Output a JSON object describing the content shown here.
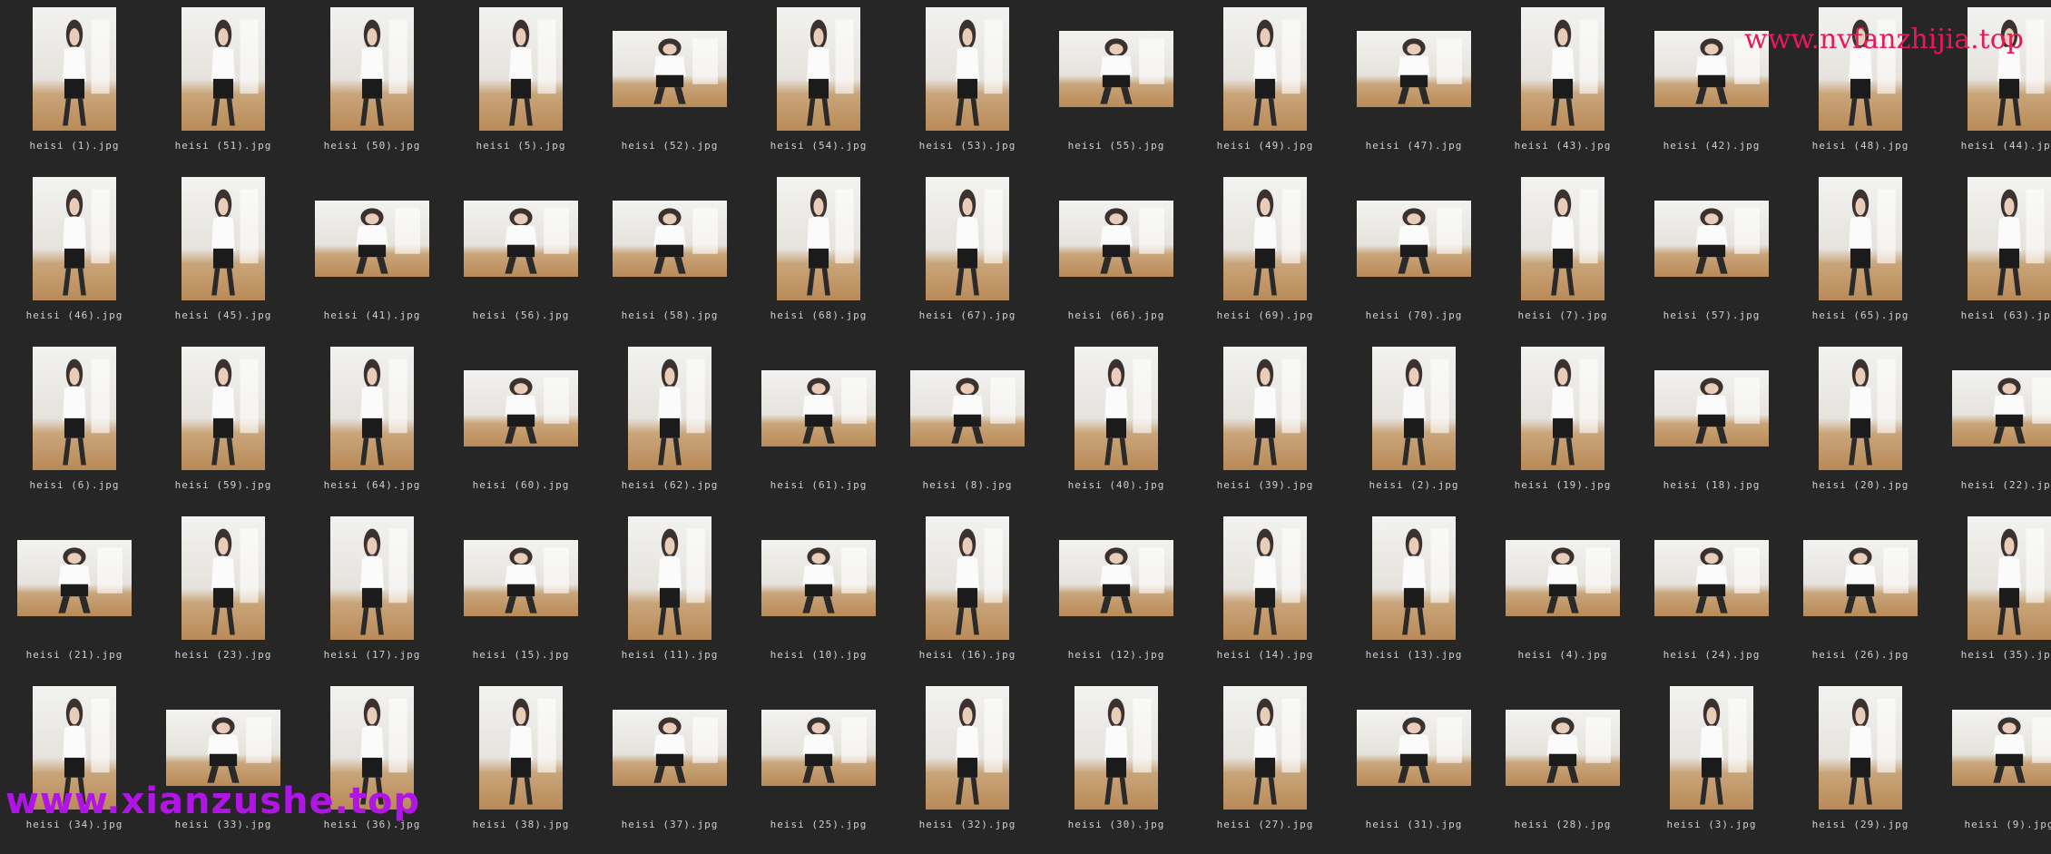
{
  "window": {
    "name": "thumbnail-view"
  },
  "watermarks": {
    "top_right": "www.nvfanzhijia.top",
    "bottom_left": "www.xianzushe.top"
  },
  "rows": [
    [
      {
        "label": "heisi (1).jpg",
        "orientation": "portrait"
      },
      {
        "label": "heisi (51).jpg",
        "orientation": "portrait"
      },
      {
        "label": "heisi (50).jpg",
        "orientation": "portrait"
      },
      {
        "label": "heisi (5).jpg",
        "orientation": "portrait"
      },
      {
        "label": "heisi (52).jpg",
        "orientation": "landscape"
      },
      {
        "label": "heisi (54).jpg",
        "orientation": "portrait"
      },
      {
        "label": "heisi (53).jpg",
        "orientation": "portrait"
      },
      {
        "label": "heisi (55).jpg",
        "orientation": "landscape"
      },
      {
        "label": "heisi (49).jpg",
        "orientation": "portrait"
      },
      {
        "label": "heisi (47).jpg",
        "orientation": "landscape"
      },
      {
        "label": "heisi (43).jpg",
        "orientation": "portrait"
      },
      {
        "label": "heisi (42).jpg",
        "orientation": "landscape"
      },
      {
        "label": "heisi (48).jpg",
        "orientation": "portrait"
      },
      {
        "label": "heisi (44).jpg",
        "orientation": "portrait"
      }
    ],
    [
      {
        "label": "heisi (46).jpg",
        "orientation": "portrait"
      },
      {
        "label": "heisi (45).jpg",
        "orientation": "portrait"
      },
      {
        "label": "heisi (41).jpg",
        "orientation": "landscape"
      },
      {
        "label": "heisi (56).jpg",
        "orientation": "landscape"
      },
      {
        "label": "heisi (58).jpg",
        "orientation": "landscape"
      },
      {
        "label": "heisi (68).jpg",
        "orientation": "portrait"
      },
      {
        "label": "heisi (67).jpg",
        "orientation": "portrait"
      },
      {
        "label": "heisi (66).jpg",
        "orientation": "landscape"
      },
      {
        "label": "heisi (69).jpg",
        "orientation": "portrait"
      },
      {
        "label": "heisi (70).jpg",
        "orientation": "landscape"
      },
      {
        "label": "heisi (7).jpg",
        "orientation": "portrait"
      },
      {
        "label": "heisi (57).jpg",
        "orientation": "landscape"
      },
      {
        "label": "heisi (65).jpg",
        "orientation": "portrait"
      },
      {
        "label": "heisi (63).jpg",
        "orientation": "portrait"
      }
    ],
    [
      {
        "label": "heisi (6).jpg",
        "orientation": "portrait"
      },
      {
        "label": "heisi (59).jpg",
        "orientation": "portrait"
      },
      {
        "label": "heisi (64).jpg",
        "orientation": "portrait"
      },
      {
        "label": "heisi (60).jpg",
        "orientation": "landscape"
      },
      {
        "label": "heisi (62).jpg",
        "orientation": "portrait"
      },
      {
        "label": "heisi (61).jpg",
        "orientation": "landscape"
      },
      {
        "label": "heisi (8).jpg",
        "orientation": "landscape"
      },
      {
        "label": "heisi (40).jpg",
        "orientation": "portrait"
      },
      {
        "label": "heisi (39).jpg",
        "orientation": "portrait"
      },
      {
        "label": "heisi (2).jpg",
        "orientation": "portrait"
      },
      {
        "label": "heisi (19).jpg",
        "orientation": "portrait"
      },
      {
        "label": "heisi (18).jpg",
        "orientation": "landscape"
      },
      {
        "label": "heisi (20).jpg",
        "orientation": "portrait"
      },
      {
        "label": "heisi (22).jpg",
        "orientation": "landscape"
      }
    ],
    [
      {
        "label": "heisi (21).jpg",
        "orientation": "landscape"
      },
      {
        "label": "heisi (23).jpg",
        "orientation": "portrait"
      },
      {
        "label": "heisi (17).jpg",
        "orientation": "portrait"
      },
      {
        "label": "heisi (15).jpg",
        "orientation": "landscape"
      },
      {
        "label": "heisi (11).jpg",
        "orientation": "portrait"
      },
      {
        "label": "heisi (10).jpg",
        "orientation": "landscape"
      },
      {
        "label": "heisi (16).jpg",
        "orientation": "portrait"
      },
      {
        "label": "heisi (12).jpg",
        "orientation": "landscape"
      },
      {
        "label": "heisi (14).jpg",
        "orientation": "portrait"
      },
      {
        "label": "heisi (13).jpg",
        "orientation": "portrait"
      },
      {
        "label": "heisi (4).jpg",
        "orientation": "landscape"
      },
      {
        "label": "heisi (24).jpg",
        "orientation": "landscape"
      },
      {
        "label": "heisi (26).jpg",
        "orientation": "landscape"
      },
      {
        "label": "heisi (35).jpg",
        "orientation": "portrait"
      }
    ],
    [
      {
        "label": "heisi (34).jpg",
        "orientation": "portrait"
      },
      {
        "label": "heisi (33).jpg",
        "orientation": "landscape"
      },
      {
        "label": "heisi (36).jpg",
        "orientation": "portrait"
      },
      {
        "label": "heisi (38).jpg",
        "orientation": "portrait"
      },
      {
        "label": "heisi (37).jpg",
        "orientation": "landscape"
      },
      {
        "label": "heisi (25).jpg",
        "orientation": "landscape"
      },
      {
        "label": "heisi (32).jpg",
        "orientation": "portrait"
      },
      {
        "label": "heisi (30).jpg",
        "orientation": "portrait"
      },
      {
        "label": "heisi (27).jpg",
        "orientation": "portrait"
      },
      {
        "label": "heisi (31).jpg",
        "orientation": "landscape"
      },
      {
        "label": "heisi (28).jpg",
        "orientation": "landscape"
      },
      {
        "label": "heisi (3).jpg",
        "orientation": "portrait"
      },
      {
        "label": "heisi (29).jpg",
        "orientation": "portrait"
      },
      {
        "label": "heisi (9).jpg",
        "orientation": "landscape"
      }
    ]
  ]
}
